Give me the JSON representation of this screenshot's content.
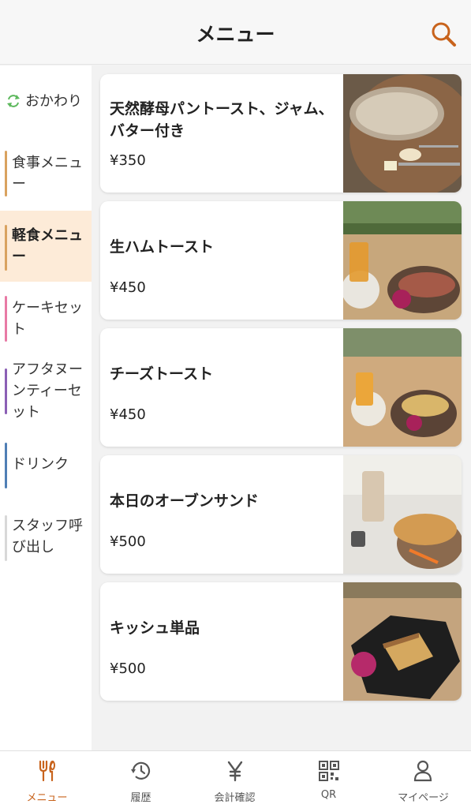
{
  "header": {
    "title": "メニュー",
    "search_icon": "search-icon"
  },
  "sidebar": {
    "items": [
      {
        "label": "おかわり",
        "icon": "refresh-icon",
        "color": "#5cb85c"
      },
      {
        "label": "食事メニュー",
        "color": "#d9a25f"
      },
      {
        "label": "軽食メニュー",
        "color": "#d9a25f",
        "active": true
      },
      {
        "label": "ケーキセット",
        "color": "#e87aa5"
      },
      {
        "label": "アフタヌーンティーセット",
        "color": "#8b5fb5"
      },
      {
        "label": "ドリンク",
        "color": "#4f7fb5"
      },
      {
        "label": "スタッフ呼び出し",
        "color": "#d8d8d8"
      }
    ]
  },
  "menu": {
    "items": [
      {
        "name": "天然酵母パントースト、ジャム、バター付き",
        "price": "¥350",
        "image": "bread-toast-photo"
      },
      {
        "name": "生ハムトースト",
        "price": "¥450",
        "image": "ham-toast-photo"
      },
      {
        "name": "チーズトースト",
        "price": "¥450",
        "image": "cheese-toast-photo"
      },
      {
        "name": "本日のオーブンサンド",
        "price": "¥500",
        "image": "oven-sandwich-photo"
      },
      {
        "name": "キッシュ単品",
        "price": "¥500",
        "image": "quiche-photo"
      }
    ]
  },
  "tabs": [
    {
      "label": "メニュー",
      "icon": "fork-knife-icon",
      "active": true
    },
    {
      "label": "履歴",
      "icon": "history-icon"
    },
    {
      "label": "会計確認",
      "icon": "yen-icon"
    },
    {
      "label": "QR",
      "icon": "qr-code-icon"
    },
    {
      "label": "マイページ",
      "icon": "person-icon"
    }
  ],
  "colors": {
    "accent": "#c8631c",
    "active_bg": "#fdebd8"
  }
}
